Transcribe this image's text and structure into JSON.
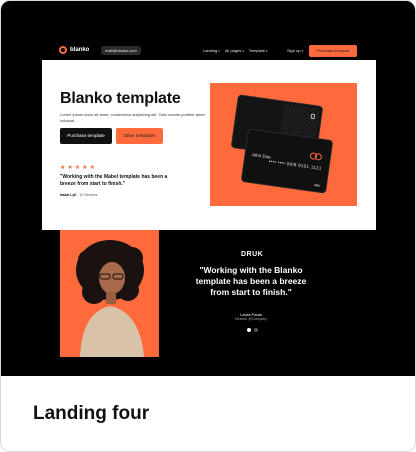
{
  "nav": {
    "logo_text": "blanko",
    "email": "mail@blanko.com",
    "links": [
      "Landing",
      "All pages",
      "Template"
    ],
    "signup": "Sign up",
    "purchase": "Purchase template"
  },
  "hero": {
    "title": "Blanko template",
    "subtitle": "Lorem ipsum dolor sit amet, consectetur adipiscing elit. Odio mauris porttitor amet volutpat.",
    "primary_button": "Purchase template",
    "secondary_button": "Other templates",
    "stars": "★★★★★",
    "quote": "\"Working with the Mabel template has been a breeze from start to finish.\"",
    "reviewer_name": "Nakai Lyli",
    "reviewer_meta": " · 10 Reviews"
  },
  "card": {
    "name": "John Doe",
    "number": "•••• •••• 06/8 9101 1121"
  },
  "testimonial": {
    "brand": "DRUK",
    "quote": "\"Working with the Blanko template has been a breeze from start to finish.\"",
    "name": "Laura Paula",
    "role": "Director @Company",
    "slides": 2,
    "active_slide": 1
  },
  "caption": "Landing four",
  "colors": {
    "accent": "#ff6a3d",
    "background": "#000000",
    "panel": "#ffffff"
  }
}
